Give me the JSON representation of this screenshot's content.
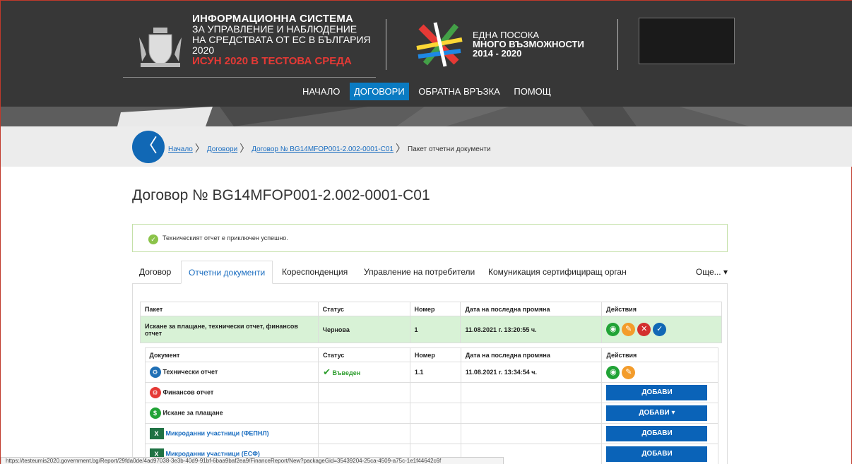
{
  "header": {
    "brand_line1": "ИНФОРМАЦИОННА СИСТЕМА",
    "brand_line2": "ЗА УПРАВЛЕНИЕ И НАБЛЮДЕНИЕ",
    "brand_line3": "НА СРЕДСТВАТА ОТ ЕС В БЪЛГАРИЯ",
    "brand_line4": "2020",
    "brand_line5": "ИСУН 2020 В ТЕСТОВА СРЕДА",
    "eu_line1": "ЕДНА ПОСОКА",
    "eu_line2": "МНОГО ВЪЗМОЖНОСТИ",
    "eu_line3": "2014 - 2020"
  },
  "nav": {
    "items": [
      "НАЧАЛО",
      "ДОГОВОРИ",
      "ОБРАТНА ВРЪЗКА",
      "ПОМОЩ"
    ],
    "active": "ДОГОВОРИ"
  },
  "breadcrumb": {
    "items": [
      "Начало",
      "Договори",
      "Договор № BG14MFOP001-2.002-0001-C01"
    ],
    "current": "Пакет отчетни документи"
  },
  "page_title": "Договор № BG14MFOP001-2.002-0001-C01",
  "alert": {
    "message": "Техническият отчет е приключен успешно."
  },
  "tabs": {
    "items": [
      "Договор",
      "Отчетни документи",
      "Кореспонденция",
      "Управление на потребители",
      "Комуникация сертифициращ орган"
    ],
    "active": "Отчетни документи",
    "more": "Още..."
  },
  "package_table": {
    "headers": [
      "Пакет",
      "Статус",
      "Номер",
      "Дата на последна промяна",
      "Действия"
    ],
    "row": {
      "name": "Искане за плащане, технически отчет, финансов отчет",
      "status": "Чернова",
      "number": "1",
      "date": "11.08.2021 г. 13:20:55 ч."
    }
  },
  "document_table": {
    "headers": [
      "Документ",
      "Статус",
      "Номер",
      "Дата на последна промяна",
      "Действия"
    ],
    "rows": [
      {
        "name": "Технически отчет",
        "status": "Въведен",
        "number": "1.1",
        "date": "11.08.2021 г. 13:34:54 ч.",
        "icon": "technical-report-icon",
        "color": "#1f6fb5"
      },
      {
        "name": "Финансов отчет",
        "status": "",
        "number": "",
        "date": "",
        "action": "ДОБАВИ",
        "icon": "financial-report-icon",
        "color": "#e53935"
      },
      {
        "name": "Искане за плащане",
        "status": "",
        "number": "",
        "date": "",
        "action": "ДОБАВИ ▾",
        "icon": "payment-request-icon",
        "color": "#21a336"
      },
      {
        "name": "Микроданни участници (ФЕПНЛ)",
        "status": "",
        "number": "",
        "date": "",
        "action": "ДОБАВИ",
        "icon": "excel-icon"
      },
      {
        "name": "Микроданни участници (ЕСФ)",
        "status": "",
        "number": "",
        "date": "",
        "action": "ДОБАВИ",
        "icon": "excel-icon"
      }
    ]
  },
  "status_url": "https://testeumis2020.government.bg/Report/29fda0de/4ad97038-3e3b-40d9-91bf-6baa9baf2ea9/FinanceReport/New?packageGid=35439204-25ca-4509-a75c-1e1f44642c6f"
}
